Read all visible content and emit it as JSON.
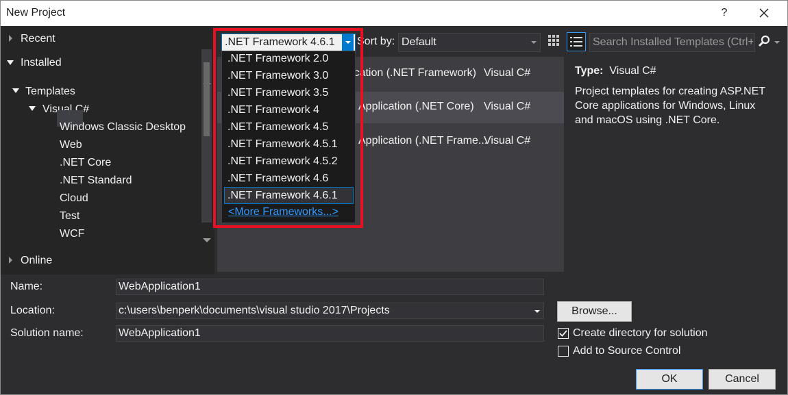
{
  "window": {
    "title": "New Project",
    "help_label": "?"
  },
  "tree": {
    "recent": "Recent",
    "installed": "Installed",
    "templates": "Templates",
    "visual_csharp": "Visual C#",
    "children": [
      "Windows Classic Desktop",
      "Web",
      ".NET Core",
      ".NET Standard",
      "Cloud",
      "Test",
      "WCF"
    ],
    "online": "Online",
    "selected": "Web"
  },
  "framework": {
    "selected": ".NET Framework 4.6.1",
    "options": [
      ".NET Framework 2.0",
      ".NET Framework 3.0",
      ".NET Framework 3.5",
      ".NET Framework 4",
      ".NET Framework 4.5",
      ".NET Framework 4.5.1",
      ".NET Framework 4.5.2",
      ".NET Framework 4.6",
      ".NET Framework 4.6.1"
    ],
    "more": "<More Frameworks...>"
  },
  "sort": {
    "label": "Sort by:",
    "value": "Default"
  },
  "search": {
    "placeholder": "Search Installed Templates (Ctrl+E)"
  },
  "templates": [
    {
      "name": "ication (.NET Framework)",
      "lang": "Visual C#"
    },
    {
      "name": "Application (.NET Core)",
      "lang": "Visual C#"
    },
    {
      "name": "Application (.NET Frame...",
      "lang": "Visual C#"
    }
  ],
  "details": {
    "type_label": "Type:",
    "type_value": "Visual C#",
    "description": "Project templates for creating ASP.NET Core applications for Windows, Linux and macOS using .NET Core."
  },
  "form": {
    "name_label": "Name:",
    "name_value": "WebApplication1",
    "location_label": "Location:",
    "location_value": "c:\\users\\benperk\\documents\\visual studio 2017\\Projects",
    "solution_label": "Solution name:",
    "solution_value": "WebApplication1",
    "browse": "Browse...",
    "create_dir": "Create directory for solution",
    "create_dir_checked": true,
    "source_control": "Add to Source Control",
    "source_control_checked": false,
    "ok": "OK",
    "cancel": "Cancel"
  },
  "colors": {
    "accent": "#007acc",
    "highlight": "#e81123",
    "background": "#2d2d30"
  }
}
